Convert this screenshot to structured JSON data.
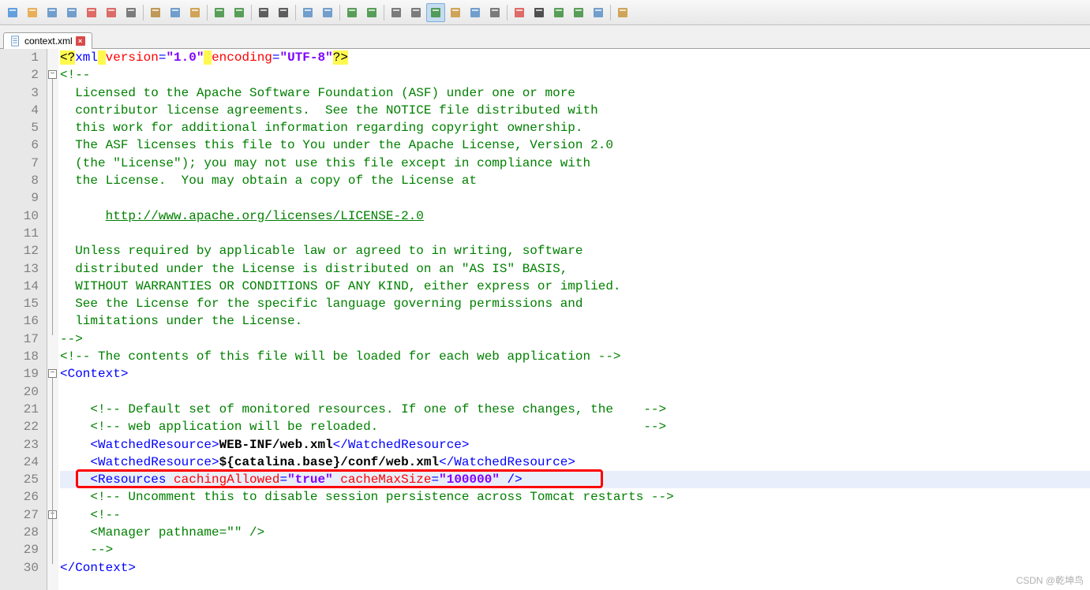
{
  "toolbar": {
    "icons": [
      {
        "name": "new-file-icon"
      },
      {
        "name": "open-folder-icon"
      },
      {
        "name": "save-icon"
      },
      {
        "name": "save-all-icon"
      },
      {
        "name": "close-file-icon"
      },
      {
        "name": "close-all-icon"
      },
      {
        "name": "print-icon"
      },
      {
        "sep": true
      },
      {
        "name": "cut-icon"
      },
      {
        "name": "copy-icon"
      },
      {
        "name": "paste-icon"
      },
      {
        "sep": true
      },
      {
        "name": "undo-icon"
      },
      {
        "name": "redo-icon"
      },
      {
        "sep": true
      },
      {
        "name": "find-icon"
      },
      {
        "name": "replace-icon"
      },
      {
        "sep": true
      },
      {
        "name": "zoom-in-icon"
      },
      {
        "name": "zoom-out-icon"
      },
      {
        "sep": true
      },
      {
        "name": "sync-v-icon"
      },
      {
        "name": "sync-h-icon"
      },
      {
        "sep": true
      },
      {
        "name": "wrap-icon"
      },
      {
        "name": "show-ws-icon"
      },
      {
        "name": "indent-guide-icon",
        "active": true
      },
      {
        "name": "user-lang-icon"
      },
      {
        "name": "doc-map-icon"
      },
      {
        "name": "func-list-icon"
      },
      {
        "sep": true
      },
      {
        "name": "record-macro-icon"
      },
      {
        "name": "stop-macro-icon"
      },
      {
        "name": "play-macro-icon"
      },
      {
        "name": "play-multi-icon"
      },
      {
        "name": "save-macro-icon"
      },
      {
        "sep": true
      },
      {
        "name": "compare-icon"
      }
    ]
  },
  "tabs": [
    {
      "label": "context.xml",
      "active": true
    }
  ],
  "code": {
    "lines": [
      {
        "n": 1,
        "type": "pi",
        "html": "<span class='sx-pi'>&lt;?</span><span class='sx-keyw'>xml</span><span class='sx-pi'> </span><span class='sx-attr'>version</span><span class='sx-keyw'>=</span><span class='sx-str'>\"1.0\"</span><span class='sx-pi'> </span><span class='sx-attr'>encoding</span><span class='sx-keyw'>=</span><span class='sx-str'>\"UTF-8\"</span><span class='sx-pi'>?&gt;</span>"
      },
      {
        "n": 2,
        "html": "<span class='sx-cmt'>&lt;!--</span>",
        "fold": "minus"
      },
      {
        "n": 3,
        "html": "<span class='sx-cmt'>  Licensed to the Apache Software Foundation (ASF) under one or more</span>"
      },
      {
        "n": 4,
        "html": "<span class='sx-cmt'>  contributor license agreements.  See the NOTICE file distributed with</span>"
      },
      {
        "n": 5,
        "html": "<span class='sx-cmt'>  this work for additional information regarding copyright ownership.</span>"
      },
      {
        "n": 6,
        "html": "<span class='sx-cmt'>  The ASF licenses this file to You under the Apache License, Version 2.0</span>"
      },
      {
        "n": 7,
        "html": "<span class='sx-cmt'>  (the \"License\"); you may not use this file except in compliance with</span>"
      },
      {
        "n": 8,
        "html": "<span class='sx-cmt'>  the License.  You may obtain a copy of the License at</span>"
      },
      {
        "n": 9,
        "html": ""
      },
      {
        "n": 10,
        "html": "<span class='sx-cmt'>      </span><span class='sx-url'>http://www.apache.org/licenses/LICENSE-2.0</span>"
      },
      {
        "n": 11,
        "html": ""
      },
      {
        "n": 12,
        "html": "<span class='sx-cmt'>  Unless required by applicable law or agreed to in writing, software</span>"
      },
      {
        "n": 13,
        "html": "<span class='sx-cmt'>  distributed under the License is distributed on an \"AS IS\" BASIS,</span>"
      },
      {
        "n": 14,
        "html": "<span class='sx-cmt'>  WITHOUT WARRANTIES OR CONDITIONS OF ANY KIND, either express or implied.</span>"
      },
      {
        "n": 15,
        "html": "<span class='sx-cmt'>  See the License for the specific language governing permissions and</span>"
      },
      {
        "n": 16,
        "html": "<span class='sx-cmt'>  limitations under the License.</span>"
      },
      {
        "n": 17,
        "html": "<span class='sx-cmt'>--&gt;</span>"
      },
      {
        "n": 18,
        "html": "<span class='sx-cmt'>&lt;!-- The contents of this file will be loaded for each web application --&gt;</span>"
      },
      {
        "n": 19,
        "html": "<span class='sx-keyw'>&lt;Context&gt;</span>",
        "fold": "minus"
      },
      {
        "n": 20,
        "html": ""
      },
      {
        "n": 21,
        "html": "    <span class='sx-cmt'>&lt;!-- Default set of monitored resources. If one of these changes, the    --&gt;</span>"
      },
      {
        "n": 22,
        "html": "    <span class='sx-cmt'>&lt;!-- web application will be reloaded.                                   --&gt;</span>"
      },
      {
        "n": 23,
        "html": "    <span class='sx-keyw'>&lt;WatchedResource&gt;</span><span class='sx-txt'>WEB-INF/web.xml</span><span class='sx-keyw'>&lt;/WatchedResource&gt;</span>"
      },
      {
        "n": 24,
        "html": "    <span class='sx-keyw'>&lt;WatchedResource&gt;</span><span class='sx-txt'>${catalina.base}/conf/web.xml</span><span class='sx-keyw'>&lt;/WatchedResource&gt;</span>"
      },
      {
        "n": 25,
        "html": "    <span class='sx-keyw'>&lt;Resources </span><span class='sx-attr'>cachingAllowed</span><span class='sx-keyw'>=</span><span class='sx-str'>\"true\"</span> <span class='sx-attr'>cacheMaxSize</span><span class='sx-keyw'>=</span><span class='sx-str'>\"100000\"</span> <span class='sx-keyw'>/&gt;</span>",
        "current": true,
        "highlighted": true
      },
      {
        "n": 26,
        "html": "    <span class='sx-cmt'>&lt;!-- Uncomment this to disable session persistence across Tomcat restarts --&gt;</span>"
      },
      {
        "n": 27,
        "html": "    <span class='sx-cmt'>&lt;!--</span>",
        "fold": "minus"
      },
      {
        "n": 28,
        "html": "<span class='sx-cmt'>    &lt;Manager pathname=\"\" /&gt;</span>"
      },
      {
        "n": 29,
        "html": "<span class='sx-cmt'>    --&gt;</span>"
      },
      {
        "n": 30,
        "html": "<span class='sx-keyw'>&lt;/Context&gt;</span>"
      }
    ]
  },
  "watermark": "CSDN @乾坤鸟"
}
